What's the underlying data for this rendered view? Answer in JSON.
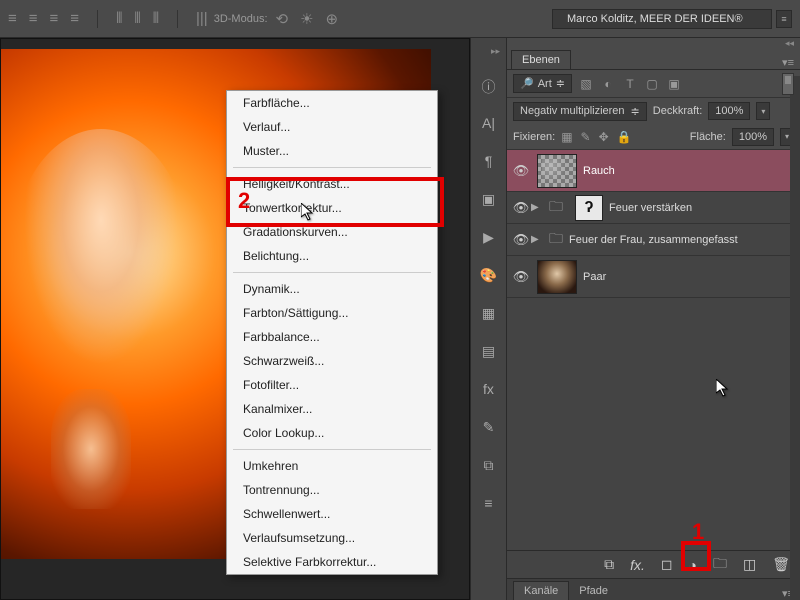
{
  "top": {
    "mode_3d": "3D-Modus:",
    "artist": "Marco Kolditz, MEER DER IDEEN®"
  },
  "menu": {
    "items": [
      {
        "label": "Farbfläche...",
        "sep_after": false
      },
      {
        "label": "Verlauf...",
        "sep_after": false
      },
      {
        "label": "Muster...",
        "sep_after": true
      },
      {
        "label": "Helligkeit/Kontrast...",
        "sep_after": false
      },
      {
        "label": "Tonwertkorrektur...",
        "sep_after": false
      },
      {
        "label": "Gradationskurven...",
        "sep_after": false
      },
      {
        "label": "Belichtung...",
        "sep_after": true
      },
      {
        "label": "Dynamik...",
        "sep_after": false
      },
      {
        "label": "Farbton/Sättigung...",
        "sep_after": false
      },
      {
        "label": "Farbbalance...",
        "sep_after": false
      },
      {
        "label": "Schwarzweiß...",
        "sep_after": false
      },
      {
        "label": "Fotofilter...",
        "sep_after": false
      },
      {
        "label": "Kanalmixer...",
        "sep_after": false
      },
      {
        "label": "Color Lookup...",
        "sep_after": true
      },
      {
        "label": "Umkehren",
        "sep_after": false
      },
      {
        "label": "Tontrennung...",
        "sep_after": false
      },
      {
        "label": "Schwellenwert...",
        "sep_after": false
      },
      {
        "label": "Verlaufsumsetzung...",
        "sep_after": false
      },
      {
        "label": "Selektive Farbkorrektur...",
        "sep_after": false
      }
    ]
  },
  "panel": {
    "tab_layers": "Ebenen",
    "filter_kind": "Art",
    "blend_mode": "Negativ multiplizieren",
    "opacity_label": "Deckkraft:",
    "opacity_value": "100%",
    "lock_label": "Fixieren:",
    "fill_label": "Fläche:",
    "fill_value": "100%",
    "layers": {
      "rauch": "Rauch",
      "feuer_verst": "Feuer verstärken",
      "feuer_frau": "Feuer der Frau, zusammengefasst",
      "paar": "Paar"
    },
    "lower_tabs": {
      "channels": "Kanäle",
      "paths": "Pfade"
    }
  },
  "annotations": {
    "num1": "1",
    "num2": "2"
  }
}
